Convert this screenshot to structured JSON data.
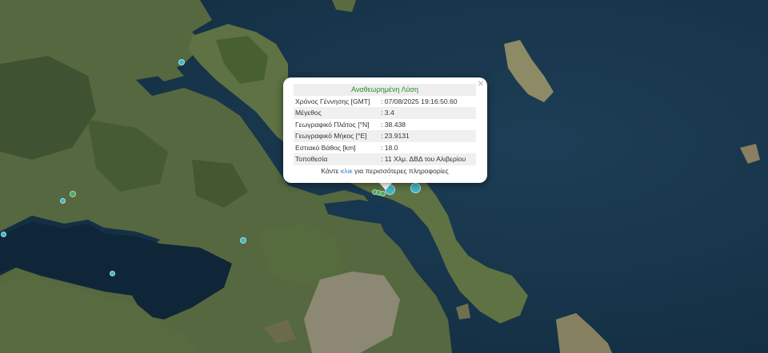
{
  "popup": {
    "title": "Αναθεωρημένη Λύση",
    "close_symbol": "×",
    "rows": [
      {
        "label": "Χρόνος Γέννησης [GMT]",
        "value": ": 07/08/2025 19:16:50.60"
      },
      {
        "label": "Μέγεθος",
        "value": ": 3.4"
      },
      {
        "label": "Γεωγραφικό Πλάτος [°N]",
        "value": ": 38.438"
      },
      {
        "label": "Γεωγραφικό Μήκος [°E]",
        "value": ": 23.9131"
      },
      {
        "label": "Εστιακό Βάθος [km]",
        "value": ": 18.0"
      },
      {
        "label": "Τοποθεσία",
        "value": ": 11 Χλμ. ΔΒΔ του Αλιβερίου"
      }
    ],
    "more_prefix": "Κάντε ",
    "more_link": "κλικ",
    "more_suffix": " για περισσότερες πληροφορίες"
  },
  "colors": {
    "sea": "#17344a",
    "land": "#4d5f3a",
    "marker_teal": "#3fb7c6",
    "marker_green": "#4fa860",
    "popup_title": "#2e8b2e",
    "link": "#3a80c9"
  },
  "markers": [
    {
      "name": "quake-marker-teal",
      "color": "#3fb7c6"
    },
    {
      "name": "quake-marker-green",
      "color": "#4fa860"
    }
  ]
}
